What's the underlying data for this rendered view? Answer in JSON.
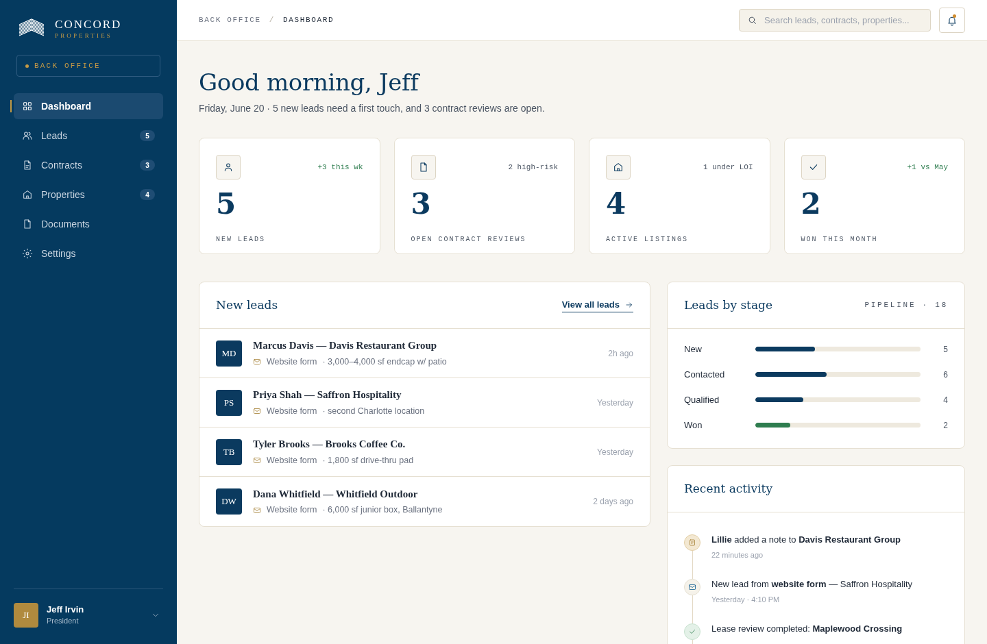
{
  "brand": {
    "name": "CONCORD",
    "tagline": "PROPERTIES"
  },
  "workspace": "BACK OFFICE",
  "nav": [
    {
      "label": "Dashboard",
      "selected": true
    },
    {
      "label": "Leads",
      "selected": false,
      "badge": "5"
    },
    {
      "label": "Contracts",
      "selected": false,
      "badge": "3"
    },
    {
      "label": "Properties",
      "selected": false,
      "badge": "4"
    },
    {
      "label": "Documents",
      "selected": false
    },
    {
      "label": "Settings",
      "selected": false
    }
  ],
  "user": {
    "initials": "JI",
    "name": "Jeff Irvin",
    "role": "President"
  },
  "breadcrumb": [
    "BACK OFFICE",
    "DASHBOARD"
  ],
  "breadcrumb_separator": "/",
  "search": {
    "placeholder": "Search leads, contracts, properties..."
  },
  "notifications": {
    "unread": true
  },
  "greeting": "Good morning, Jeff",
  "summary": "Friday, June 20 · 5 new leads need a first touch, and 3 contract reviews are open.",
  "stats": [
    {
      "value": "5",
      "label": "NEW LEADS",
      "note": "+3 this wk",
      "color": "#2e7d4f"
    },
    {
      "value": "3",
      "label": "OPEN CONTRACT REVIEWS",
      "note": "2 high-risk",
      "color": "#4b5563"
    },
    {
      "value": "4",
      "label": "ACTIVE LISTINGS",
      "note": "1 under LOI",
      "color": "#4b5563"
    },
    {
      "value": "2",
      "label": "WON THIS MONTH",
      "note": "+1 vs May",
      "color": "#2e7d4f"
    }
  ],
  "new_leads": {
    "title": "New leads",
    "link": "View all leads",
    "rows": [
      {
        "initials": "MD",
        "title": "Marcus Davis — Davis Restaurant Group",
        "source": "Website form",
        "detail": "· 3,000–4,000 sf endcap w/ patio",
        "time": "2h ago"
      },
      {
        "initials": "PS",
        "title": "Priya Shah — Saffron Hospitality",
        "source": "Website form",
        "detail": "· second Charlotte location",
        "time": "Yesterday"
      },
      {
        "initials": "TB",
        "title": "Tyler Brooks — Brooks Coffee Co.",
        "source": "Website form",
        "detail": "· 1,800 sf drive-thru pad",
        "time": "Yesterday"
      },
      {
        "initials": "DW",
        "title": "Dana Whitfield — Whitfield Outdoor",
        "source": "Website form",
        "detail": "· 6,000 sf junior box, Ballantyne",
        "time": "2 days ago"
      }
    ]
  },
  "leads_by_stage": {
    "title": "Leads by stage",
    "meta": "PIPELINE · 18",
    "stages": [
      {
        "label": "New",
        "value": "5",
        "level": 0.36,
        "color": "#0b3a5f"
      },
      {
        "label": "Contacted",
        "value": "6",
        "level": 0.43,
        "color": "#0b3a5f"
      },
      {
        "label": "Qualified",
        "value": "4",
        "level": 0.29,
        "color": "#0b3a5f"
      },
      {
        "label": "Won",
        "value": "2",
        "level": 0.21,
        "color": "#2e7d4f"
      }
    ]
  },
  "recent_activity": {
    "title": "Recent activity",
    "items": [
      {
        "kind": "note",
        "text": "**Lillie** added a note to **Davis Restaurant Group**",
        "time": "22 minutes ago"
      },
      {
        "kind": "email",
        "text": "New lead from **website form** — Saffron Hospitality",
        "time": "Yesterday · 4:10 PM"
      },
      {
        "kind": "check",
        "text": "Lease review completed: **Maplewood Crossing**"
      }
    ]
  }
}
